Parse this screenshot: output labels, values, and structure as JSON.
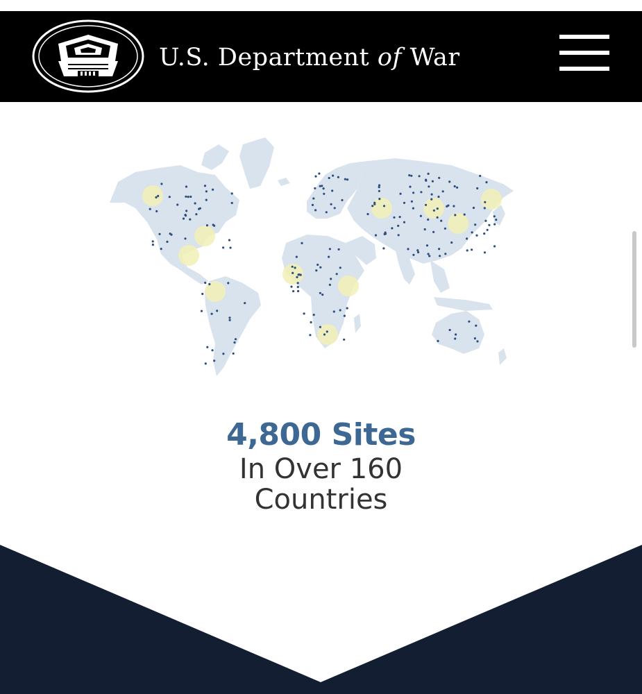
{
  "header": {
    "title_part1": "U.S. Department",
    "title_of": "of",
    "title_part2": "War",
    "logo_icon": "pentagon-seal-icon",
    "menu_icon": "hamburger-menu-icon"
  },
  "stats": {
    "value": "4,800 Sites",
    "caption": "In Over 160 Countries"
  },
  "colors": {
    "header_bg": "#000000",
    "accent_blue": "#3e6894",
    "map_land": "#d9e3ee",
    "map_dots": "#2e4f7e",
    "map_highlight": "#f2f0b6",
    "chevron_navy": "#131e32"
  }
}
